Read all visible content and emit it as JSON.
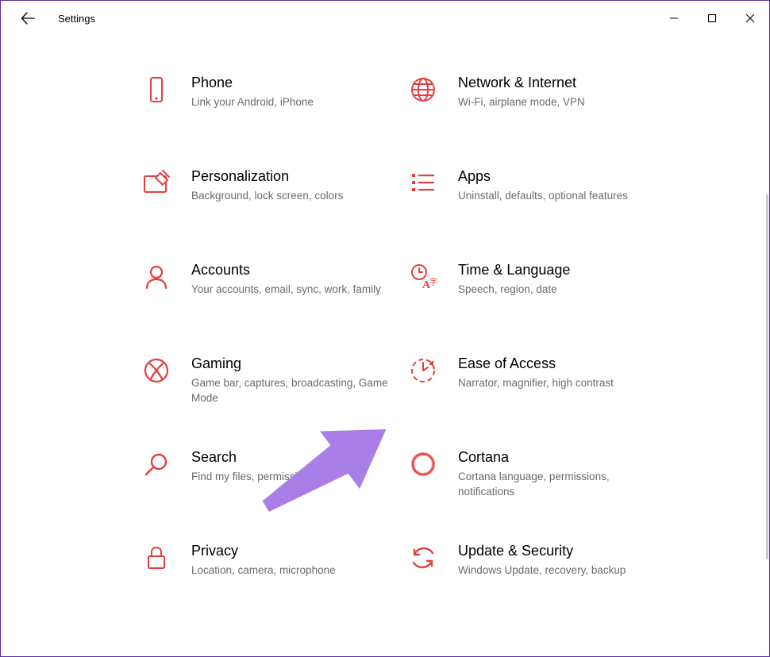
{
  "window": {
    "title": "Settings"
  },
  "colors": {
    "accent": "#e53e3e",
    "annotation": "#a97ee6"
  },
  "categories": [
    {
      "id": "phone",
      "title": "Phone",
      "desc": "Link your Android, iPhone",
      "icon": "phone-icon"
    },
    {
      "id": "network",
      "title": "Network & Internet",
      "desc": "Wi-Fi, airplane mode, VPN",
      "icon": "globe-icon"
    },
    {
      "id": "personalization",
      "title": "Personalization",
      "desc": "Background, lock screen, colors",
      "icon": "personalization-icon"
    },
    {
      "id": "apps",
      "title": "Apps",
      "desc": "Uninstall, defaults, optional features",
      "icon": "apps-list-icon"
    },
    {
      "id": "accounts",
      "title": "Accounts",
      "desc": "Your accounts, email, sync, work, family",
      "icon": "person-icon"
    },
    {
      "id": "time-language",
      "title": "Time & Language",
      "desc": "Speech, region, date",
      "icon": "time-language-icon"
    },
    {
      "id": "gaming",
      "title": "Gaming",
      "desc": "Game bar, captures, broadcasting, Game Mode",
      "icon": "xbox-icon"
    },
    {
      "id": "ease-of-access",
      "title": "Ease of Access",
      "desc": "Narrator, magnifier, high contrast",
      "icon": "ease-of-access-icon"
    },
    {
      "id": "search",
      "title": "Search",
      "desc": "Find my files, permissions",
      "icon": "search-icon"
    },
    {
      "id": "cortana",
      "title": "Cortana",
      "desc": "Cortana language, permissions, notifications",
      "icon": "cortana-icon"
    },
    {
      "id": "privacy",
      "title": "Privacy",
      "desc": "Location, camera, microphone",
      "icon": "lock-icon"
    },
    {
      "id": "update-security",
      "title": "Update & Security",
      "desc": "Windows Update, recovery, backup",
      "icon": "update-icon"
    }
  ]
}
